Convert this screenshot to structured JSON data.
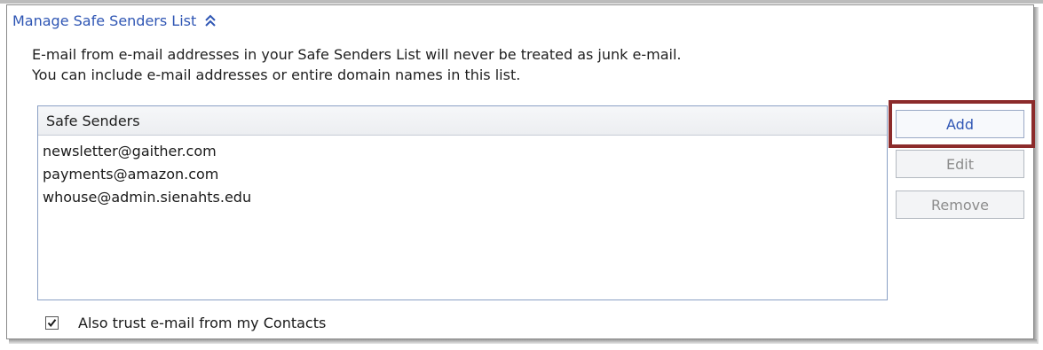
{
  "section": {
    "title": "Manage Safe Senders List",
    "collapse_icon": "double-chevron-up-icon"
  },
  "description": {
    "line1": "E-mail from e-mail addresses in your Safe Senders List will never be treated as junk e-mail.",
    "line2": "You can include e-mail addresses or entire domain names in this list."
  },
  "list": {
    "column_header": "Safe Senders",
    "items": [
      "newsletter@gaither.com",
      "payments@amazon.com",
      "whouse@admin.sienahts.edu"
    ]
  },
  "buttons": {
    "add": "Add",
    "edit": "Edit",
    "remove": "Remove"
  },
  "trust_contacts": {
    "label": "Also trust e-mail from my Contacts",
    "checked": true
  },
  "colors": {
    "link_blue": "#2f56b4",
    "highlight_red": "#8c2b2b",
    "disabled_gray": "#8c8c8c"
  }
}
